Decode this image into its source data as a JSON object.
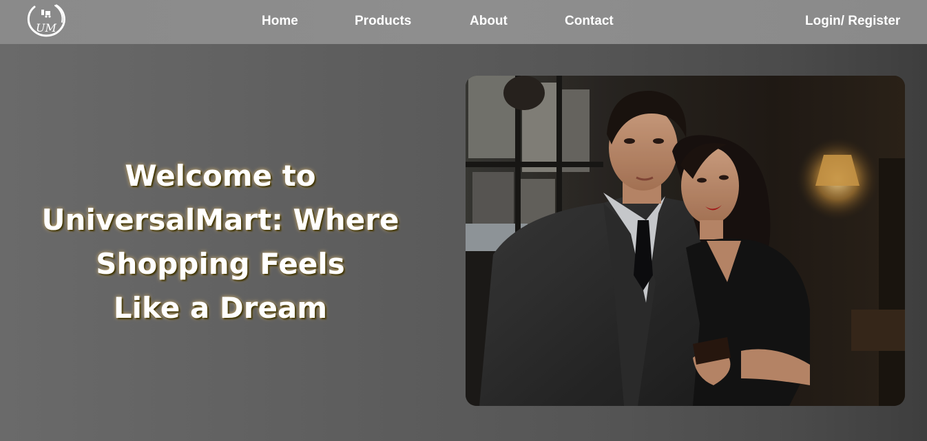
{
  "nav": {
    "logo_text": "UM",
    "links": [
      {
        "label": "Home"
      },
      {
        "label": "Products"
      },
      {
        "label": "About"
      },
      {
        "label": "Contact"
      }
    ],
    "login_label": "Login/ Register"
  },
  "hero": {
    "title_lines": [
      "Welcome to",
      "UniversalMart: Where",
      "Shopping Feels",
      "Like a Dream"
    ]
  },
  "colors": {
    "navbar": "#8a8a8a",
    "hero_bg": "#5a5a5a",
    "text": "#ffffff",
    "title_glow": "#d8b56c"
  }
}
